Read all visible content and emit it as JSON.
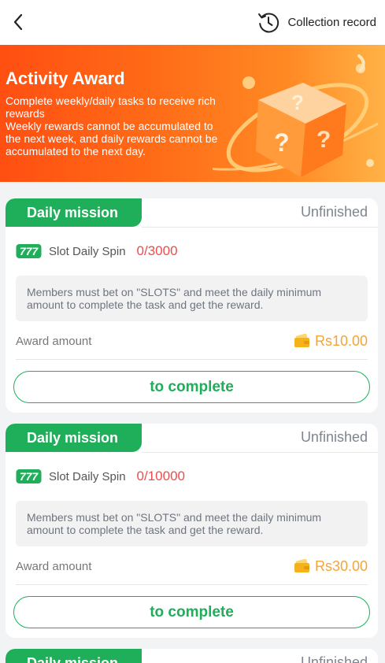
{
  "header": {
    "back_icon": "chevron-left-icon",
    "record_icon": "history-clock-icon",
    "record_label": "Collection record"
  },
  "banner": {
    "title": "Activity Award",
    "description_lines": [
      "Complete weekly/daily tasks to receive rich rewards",
      "Weekly rewards cannot be accumulated to the next week, and daily rewards cannot be accumulated to the next day."
    ],
    "art_icon": "mystery-box-icon"
  },
  "missions": [
    {
      "tab": "Daily mission",
      "status": "Unfinished",
      "task_icon": "slot-777-icon",
      "task_name": "Slot Daily Spin",
      "progress": "0/3000",
      "description": "Members must bet on \"SLOTS\" and meet the daily minimum amount to complete the task and get the reward.",
      "award_label": "Award amount",
      "award_icon": "wallet-icon",
      "award_amount": "Rs10.00",
      "button": "to complete"
    },
    {
      "tab": "Daily mission",
      "status": "Unfinished",
      "task_icon": "slot-777-icon",
      "task_name": "Slot Daily Spin",
      "progress": "0/10000",
      "description": "Members must bet on \"SLOTS\" and meet the daily minimum amount to complete the task and get the reward.",
      "award_label": "Award amount",
      "award_icon": "wallet-icon",
      "award_amount": "Rs30.00",
      "button": "to complete"
    },
    {
      "tab": "Daily mission",
      "status": "Unfinished"
    }
  ],
  "colors": {
    "accent_green": "#1fae5a",
    "progress_red": "#ef4b4b",
    "award_orange": "#f2a53b",
    "banner_orange": "#ff6b17"
  }
}
